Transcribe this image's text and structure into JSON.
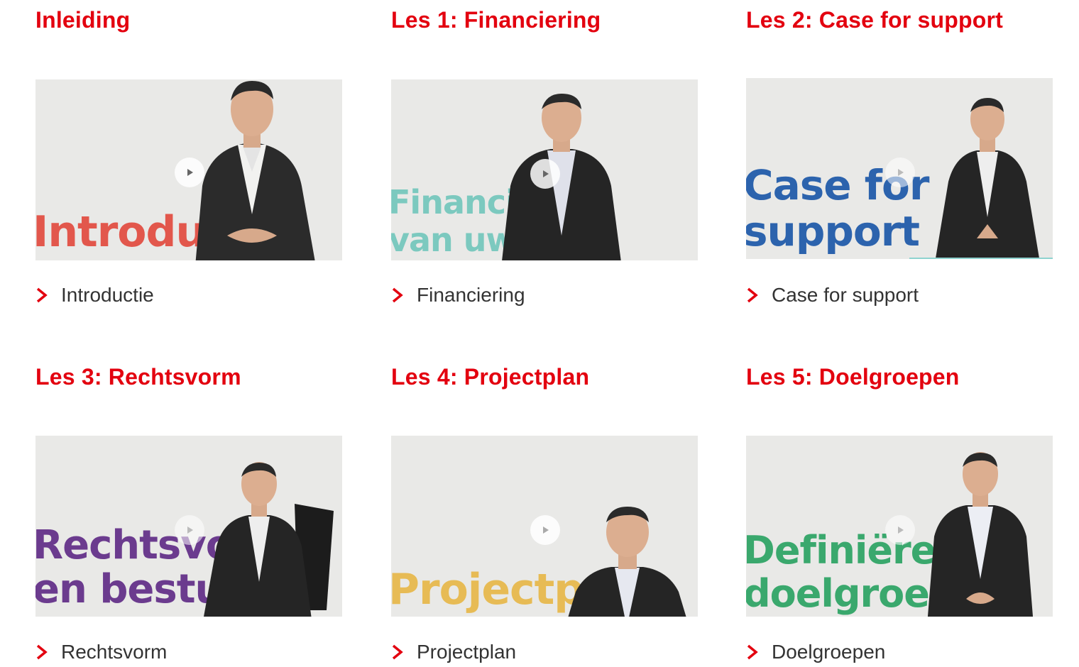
{
  "lessons": [
    {
      "title": "Inleiding",
      "overlay": [
        "Introdu"
      ],
      "link": "Introductie",
      "overlay_color": "#e2574c"
    },
    {
      "title": "Les 1: Financiering",
      "overlay": [
        "Financi",
        "van uw     ect"
      ],
      "link": "Financiering",
      "overlay_color": "#7cc9bf"
    },
    {
      "title": "Les 2: Case for support",
      "overlay": [
        "Case for",
        "support"
      ],
      "link": "Case for support",
      "overlay_color": "#2c63ad"
    },
    {
      "title": "Les 3: Rechtsvorm",
      "overlay": [
        "Rechtsvo",
        "en bestu"
      ],
      "link": "Rechtsvorm",
      "overlay_color": "#6b3b8e"
    },
    {
      "title": "Les 4: Projectplan",
      "overlay": [
        "Projectp"
      ],
      "link": "Projectplan",
      "overlay_color": "#e7bb55"
    },
    {
      "title": "Les 5: Doelgroepen",
      "overlay": [
        "Definiëre",
        "doelgroep"
      ],
      "link": "Doelgroepen",
      "overlay_color": "#3aa86d"
    }
  ],
  "colors": {
    "accent": "#e3000f",
    "link_text": "#333333",
    "video_background": "#e9e9e7"
  },
  "icons": {
    "link_chevron": "chevron-right-icon",
    "play": "play-icon"
  }
}
